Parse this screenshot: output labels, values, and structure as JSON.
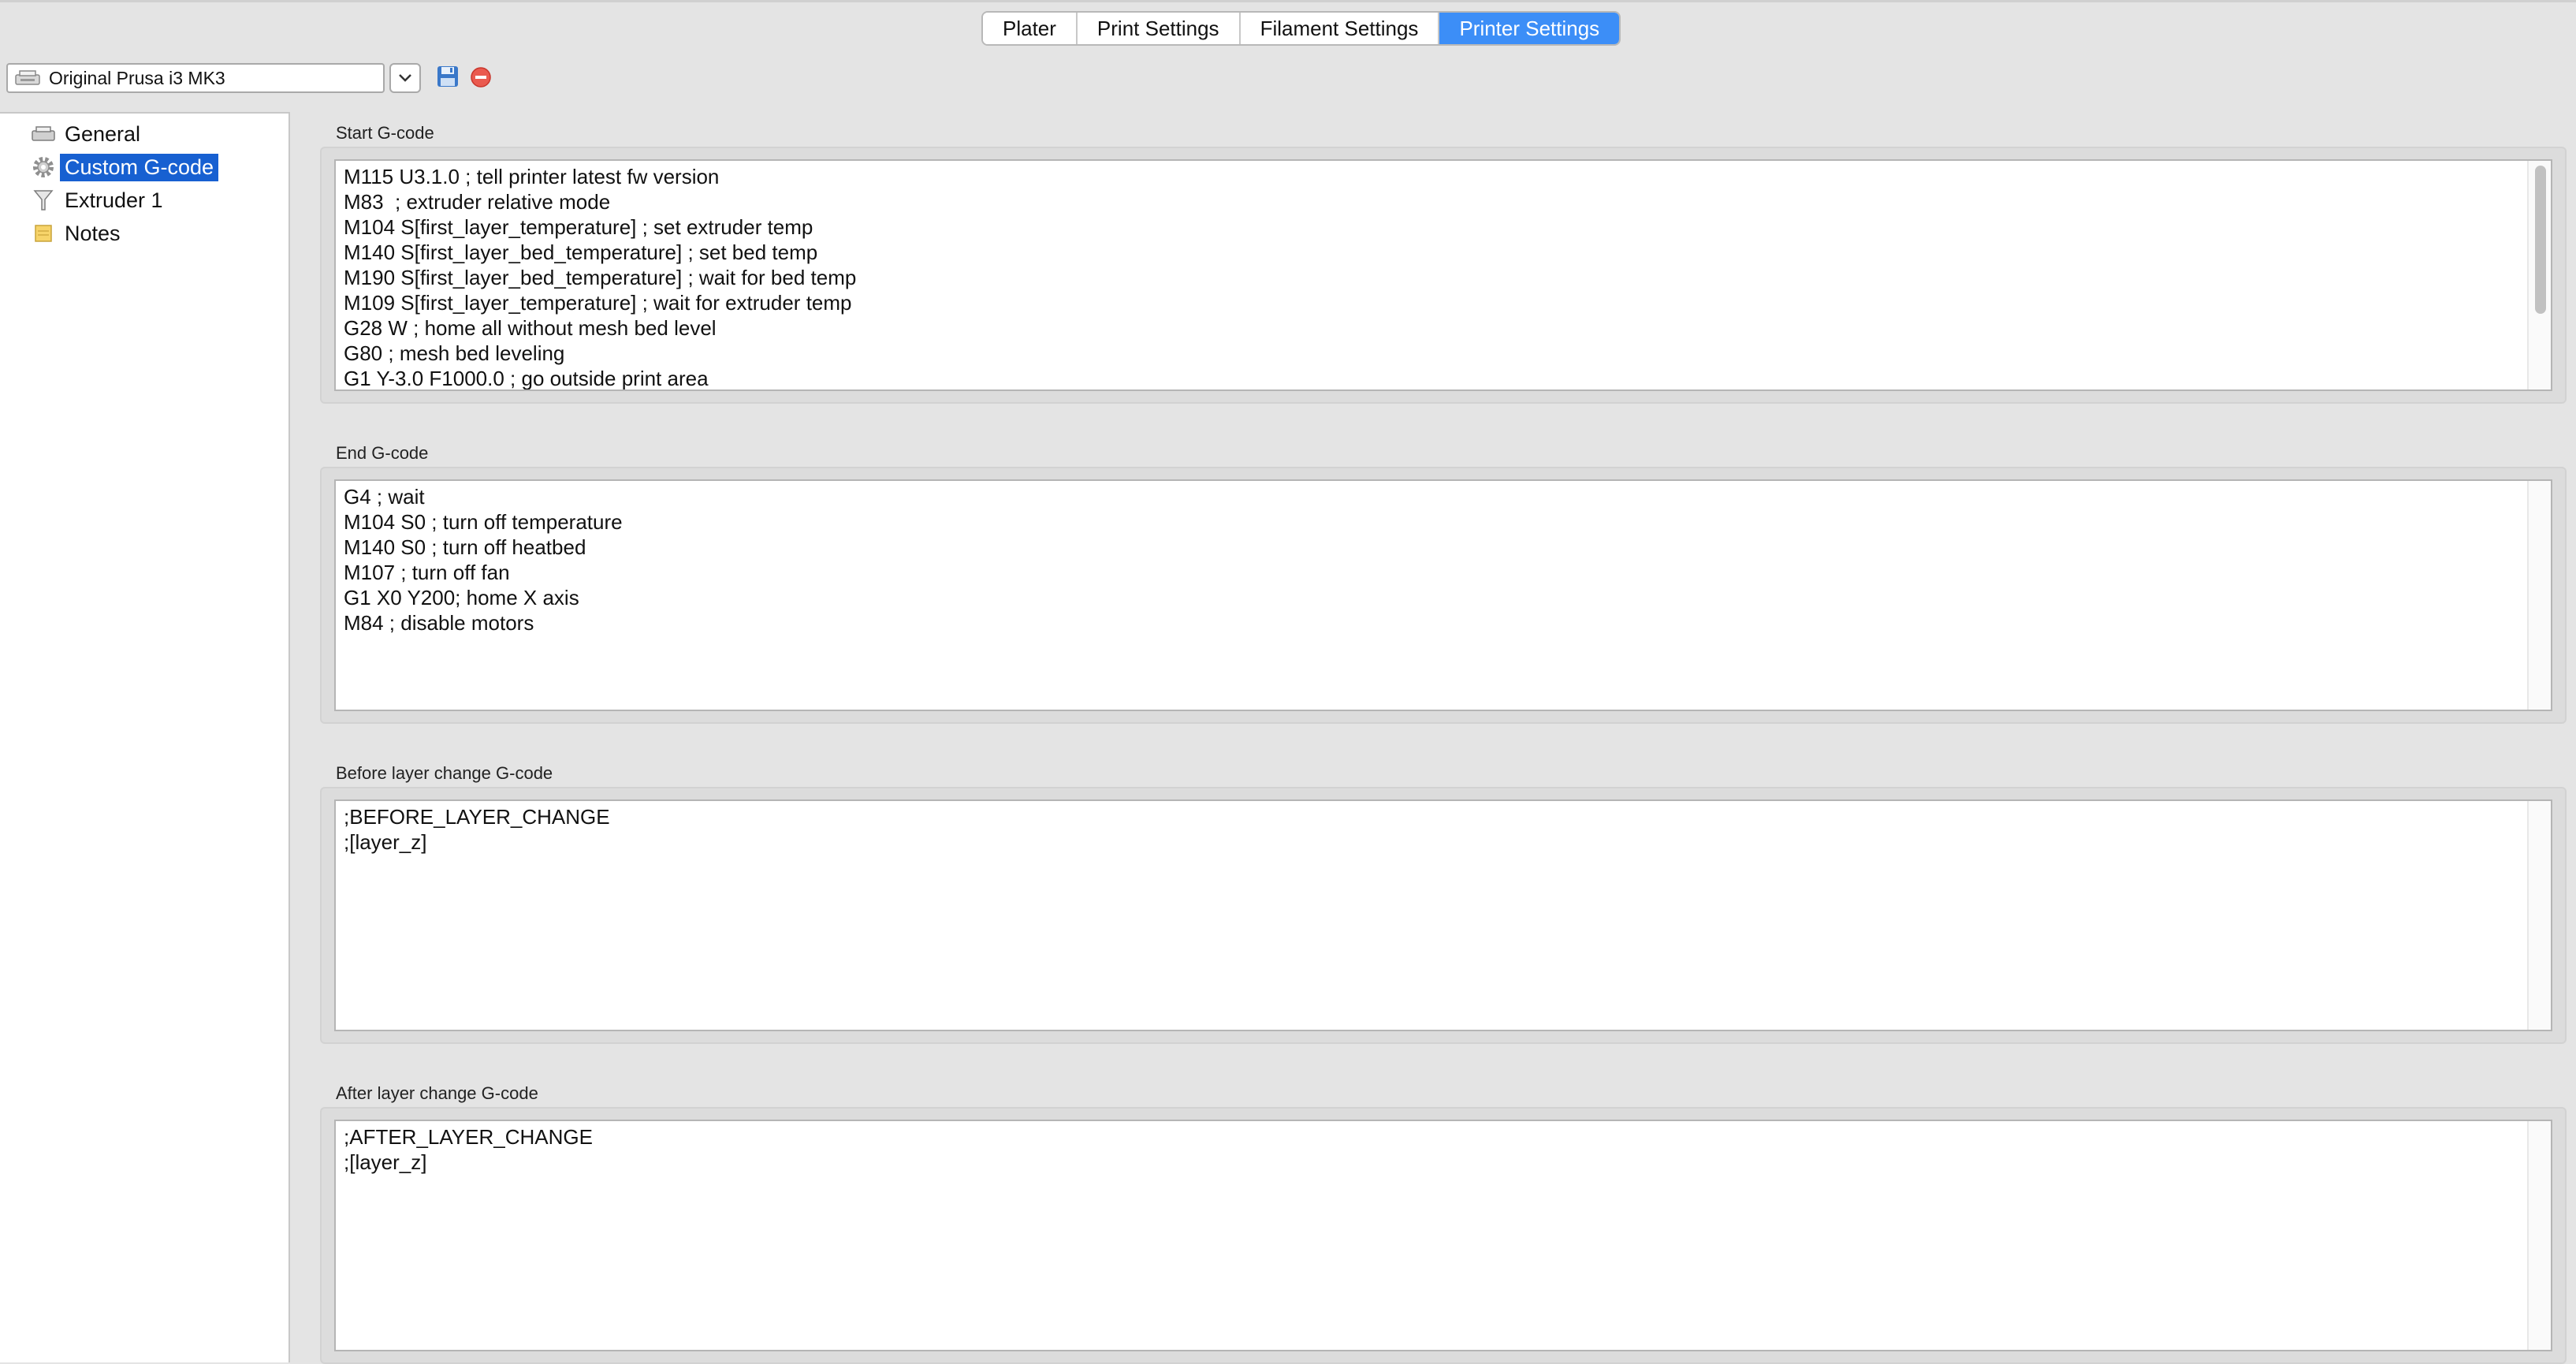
{
  "tabs": [
    {
      "label": "Plater",
      "active": false
    },
    {
      "label": "Print Settings",
      "active": false
    },
    {
      "label": "Filament Settings",
      "active": false
    },
    {
      "label": "Printer Settings",
      "active": true
    }
  ],
  "preset": {
    "selected": "Original Prusa i3 MK3",
    "icon": "printer-icon"
  },
  "toolbar": {
    "save_icon": "save-icon",
    "delete_icon": "delete-icon",
    "dropdown_icon": "chevron-down-icon"
  },
  "tree": {
    "items": [
      {
        "label": "General",
        "icon": "printer-icon",
        "selected": false
      },
      {
        "label": "Custom G-code",
        "icon": "gear-icon",
        "selected": true
      },
      {
        "label": "Extruder 1",
        "icon": "funnel-icon",
        "selected": false
      },
      {
        "label": "Notes",
        "icon": "note-icon",
        "selected": false
      }
    ]
  },
  "groups": {
    "start": {
      "title": "Start G-code",
      "lines": [
        "M115 U3.1.0 ; tell printer latest fw version",
        "M83  ; extruder relative mode",
        "M104 S[first_layer_temperature] ; set extruder temp",
        "M140 S[first_layer_bed_temperature] ; set bed temp",
        "M190 S[first_layer_bed_temperature] ; wait for bed temp",
        "M109 S[first_layer_temperature] ; wait for extruder temp",
        "G28 W ; home all without mesh bed level",
        "G80 ; mesh bed leveling",
        "G1 Y-3.0 F1000.0 ; go outside print area"
      ]
    },
    "end": {
      "title": "End G-code",
      "lines": [
        "G4 ; wait",
        "M104 S0 ; turn off temperature",
        "M140 S0 ; turn off heatbed",
        "M107 ; turn off fan",
        "G1 X0 Y200; home X axis",
        "M84 ; disable motors"
      ]
    },
    "before": {
      "title": "Before layer change G-code",
      "lines": [
        ";BEFORE_LAYER_CHANGE",
        ";[layer_z]"
      ]
    },
    "after": {
      "title": "After layer change G-code",
      "lines": [
        ";AFTER_LAYER_CHANGE",
        ";[layer_z]"
      ]
    }
  },
  "colors": {
    "accent": "#3c8ef7",
    "selection": "#1760d1",
    "background": "#e4e4e4"
  }
}
